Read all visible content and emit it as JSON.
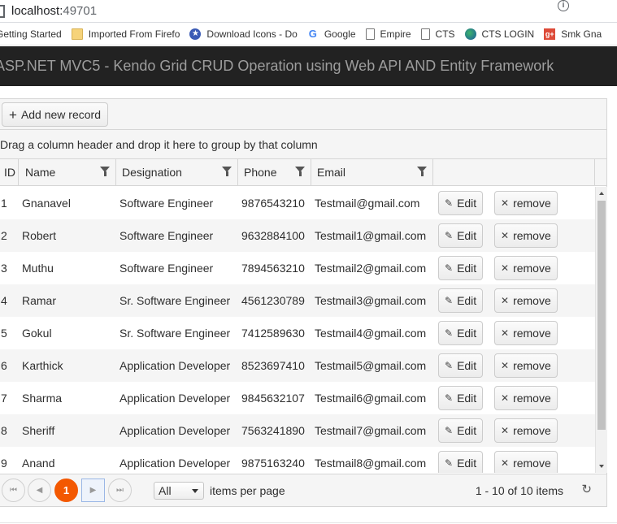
{
  "browser": {
    "url_host": "localhost:",
    "url_port": "49701",
    "bookmarks": [
      {
        "label": "Getting Started",
        "icon": "none"
      },
      {
        "label": "Imported From Firefo",
        "icon": "folder-icon"
      },
      {
        "label": "Download Icons - Do",
        "icon": "star-icon"
      },
      {
        "label": "Google",
        "icon": "google-icon"
      },
      {
        "label": "Empire",
        "icon": "page-icon"
      },
      {
        "label": "CTS",
        "icon": "page-icon"
      },
      {
        "label": "CTS LOGIN",
        "icon": "globe-icon"
      },
      {
        "label": "Smk Gna",
        "icon": "gplus-icon"
      }
    ]
  },
  "app": {
    "title": "ASP.NET MVC5 - Kendo Grid CRUD Operation using Web API AND Entity Framework"
  },
  "grid": {
    "add_label": "Add new record",
    "group_hint": "Drag a column header and drop it here to group by that column",
    "columns": [
      "ID",
      "Name",
      "Designation",
      "Phone",
      "Email"
    ],
    "edit_label": "Edit",
    "remove_label": "remove",
    "rows": [
      {
        "id": "1",
        "name": "Gnanavel",
        "designation": "Software Engineer",
        "phone": "9876543210",
        "email": "Testmail@gmail.com"
      },
      {
        "id": "2",
        "name": "Robert",
        "designation": "Software Engineer",
        "phone": "9632884100",
        "email": "Testmail1@gmail.com"
      },
      {
        "id": "3",
        "name": "Muthu",
        "designation": "Software Engineer",
        "phone": "7894563210",
        "email": "Testmail2@gmail.com"
      },
      {
        "id": "4",
        "name": "Ramar",
        "designation": "Sr. Software Engineer",
        "phone": "4561230789",
        "email": "Testmail3@gmail.com"
      },
      {
        "id": "5",
        "name": "Gokul",
        "designation": "Sr. Software Engineer",
        "phone": "7412589630",
        "email": "Testmail4@gmail.com"
      },
      {
        "id": "6",
        "name": "Karthick",
        "designation": "Application Developer",
        "phone": "8523697410",
        "email": "Testmail5@gmail.com"
      },
      {
        "id": "7",
        "name": "Sharma",
        "designation": "Application Developer",
        "phone": "9845632107",
        "email": "Testmail6@gmail.com"
      },
      {
        "id": "8",
        "name": "Sheriff",
        "designation": "Application Developer",
        "phone": "7563241890",
        "email": "Testmail7@gmail.com"
      },
      {
        "id": "9",
        "name": "Anand",
        "designation": "Application Developer",
        "phone": "9875163240",
        "email": "Testmail8@gmail.com"
      }
    ],
    "pager": {
      "current_page": "1",
      "page_size": "All",
      "per_page_label": "items per page",
      "info": "1 - 10 of 10 items"
    }
  },
  "colors": {
    "header_bg": "#222222",
    "header_text": "#9d9d9d",
    "accent": "#f35800"
  }
}
